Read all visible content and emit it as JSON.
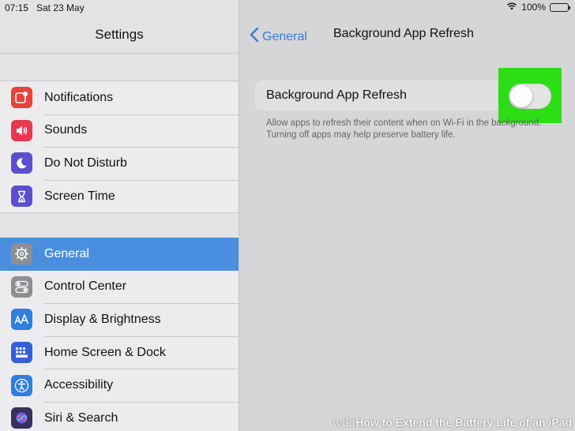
{
  "status_bar": {
    "time": "07:15",
    "date": "Sat 23 May",
    "battery": "100%",
    "battery_level": 1.0,
    "icons": [
      "wifi-icon",
      "battery-icon"
    ]
  },
  "sidebar": {
    "title": "Settings",
    "groups": [
      {
        "items": [
          {
            "label": "Notifications",
            "icon": "notifications-icon",
            "color": "#e8423a"
          },
          {
            "label": "Sounds",
            "icon": "speaker-icon",
            "color": "#e8384f"
          },
          {
            "label": "Do Not Disturb",
            "icon": "moon-icon",
            "color": "#5b4fd0"
          },
          {
            "label": "Screen Time",
            "icon": "hourglass-icon",
            "color": "#5b4fd0"
          }
        ]
      },
      {
        "items": [
          {
            "label": "General",
            "icon": "gear-icon",
            "color": "#8e8e93",
            "selected": true
          },
          {
            "label": "Control Center",
            "icon": "toggles-icon",
            "color": "#8e8e93"
          },
          {
            "label": "Display & Brightness",
            "icon": "text-size-icon",
            "color": "#2f7ee0"
          },
          {
            "label": "Home Screen & Dock",
            "icon": "grid-icon",
            "color": "#3660d8"
          },
          {
            "label": "Accessibility",
            "icon": "accessibility-icon",
            "color": "#2f7ee0"
          },
          {
            "label": "Siri & Search",
            "icon": "siri-icon",
            "color": "#3a2f5c"
          }
        ]
      }
    ]
  },
  "detail": {
    "back_label": "General",
    "title": "Background App Refresh",
    "setting_label": "Background App Refresh",
    "toggle_on": false,
    "footnote": "Allow apps to refresh their content when on Wi-Fi in the background. Turning off apps may help preserve battery life."
  },
  "watermark": {
    "prefix": "wiki",
    "text": "How to Extend the Battery Life of an iPad"
  },
  "colors": {
    "accent": "#3a7bd5",
    "selected_row": "#4a8fdf",
    "highlight": "#2ddd16"
  }
}
